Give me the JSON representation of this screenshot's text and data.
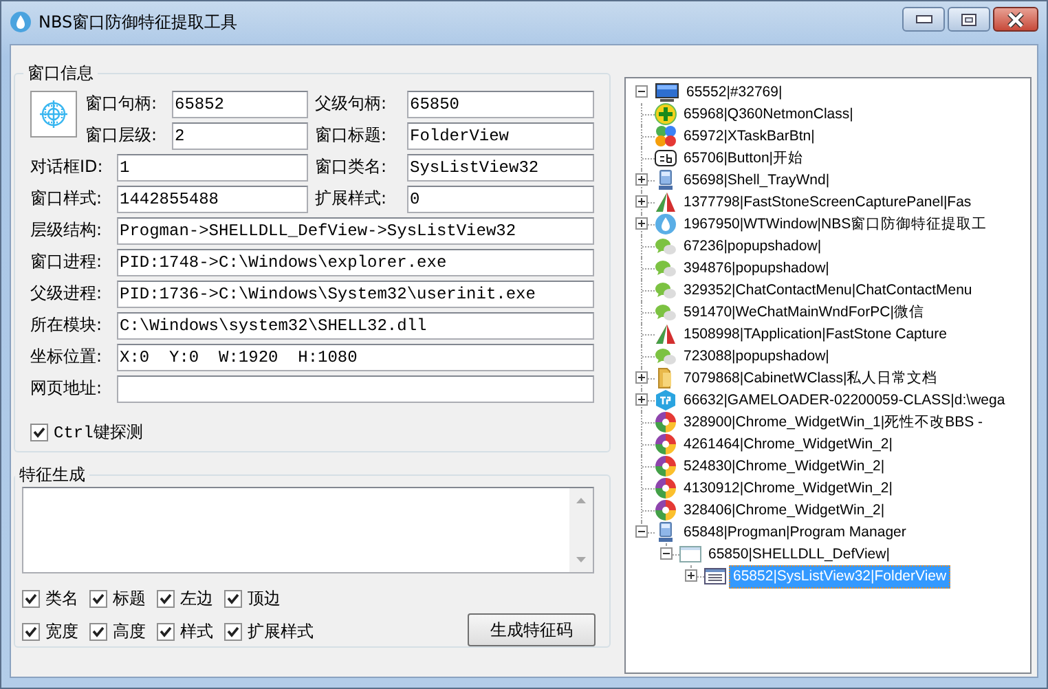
{
  "window": {
    "title": "NBS窗口防御特征提取工具"
  },
  "window_info": {
    "title": "窗口信息",
    "paired_rows": [
      {
        "left": {
          "label": "窗口句柄:",
          "value": "65852"
        },
        "right": {
          "label": "父级句柄:",
          "value": "65850"
        }
      },
      {
        "left": {
          "label": "窗口层级:",
          "value": "2"
        },
        "right": {
          "label": "窗口标题:",
          "value": "FolderView"
        }
      },
      {
        "left": {
          "label": "对话框ID:",
          "value": "1"
        },
        "right": {
          "label": "窗口类名:",
          "value": "SysListView32"
        }
      },
      {
        "left": {
          "label": "窗口样式:",
          "value": "1442855488"
        },
        "right": {
          "label": "扩展样式:",
          "value": "0"
        }
      }
    ],
    "full_rows": [
      {
        "label": "层级结构:",
        "value": "Progman->SHELLDLL_DefView->SysListView32"
      },
      {
        "label": "窗口进程:",
        "value": "PID:1748->C:\\Windows\\explorer.exe"
      },
      {
        "label": "父级进程:",
        "value": "PID:1736->C:\\Windows\\System32\\userinit.exe"
      },
      {
        "label": "所在模块:",
        "value": "C:\\Windows\\system32\\SHELL32.dll"
      },
      {
        "label": "坐标位置:",
        "value": "X:0  Y:0  W:1920  H:1080"
      },
      {
        "label": "网页地址:"
      }
    ],
    "ctrl_probe": {
      "label": "Ctrl键探测",
      "checked": true
    }
  },
  "feature": {
    "title": "特征生成",
    "options": [
      {
        "label": "类名",
        "checked": true
      },
      {
        "label": "标题",
        "checked": true
      },
      {
        "label": "左边",
        "checked": true
      },
      {
        "label": "顶边",
        "checked": true
      },
      {
        "label": "宽度",
        "checked": true
      },
      {
        "label": "高度",
        "checked": true
      },
      {
        "label": "样式",
        "checked": true
      },
      {
        "label": "扩展样式",
        "checked": true
      }
    ],
    "button": "生成特征码"
  },
  "tree": {
    "nodes": [
      {
        "label": "65552|#32769|",
        "kind": "monitor",
        "expanded": true,
        "selected": false,
        "children": [
          {
            "label": "65968|Q360NetmonClass|",
            "kind": "plus",
            "selected": false
          },
          {
            "label": "65972|XTaskBarBtn|",
            "kind": "balls",
            "selected": false
          },
          {
            "label": "65706|Button|开始",
            "kind": "textbox",
            "selected": false
          },
          {
            "label": "65698|Shell_TrayWnd|",
            "kind": "computer",
            "expanded": false,
            "selected": false
          },
          {
            "label": "1377798|FastStoneScreenCapturePanel|Fas",
            "kind": "triangle",
            "expanded": false,
            "selected": false
          },
          {
            "label": "1967950|WTWindow|NBS窗口防御特征提取工",
            "kind": "drop",
            "expanded": false,
            "selected": false
          },
          {
            "label": "67236|popupshadow|",
            "kind": "chat",
            "selected": false
          },
          {
            "label": "394876|popupshadow|",
            "kind": "chat",
            "selected": false
          },
          {
            "label": "329352|ChatContactMenu|ChatContactMenu",
            "kind": "chat",
            "selected": false
          },
          {
            "label": "591470|WeChatMainWndForPC|微信",
            "kind": "chat",
            "selected": false
          },
          {
            "label": "1508998|TApplication|FastStone Capture",
            "kind": "triangle",
            "selected": false
          },
          {
            "label": "723088|popupshadow|",
            "kind": "chat",
            "selected": false
          },
          {
            "label": "7079868|CabinetWClass|私人日常文档",
            "kind": "folder",
            "expanded": false,
            "selected": false
          },
          {
            "label": "66632|GAMELOADER-02200059-CLASS|d:\\wega",
            "kind": "hexagon",
            "expanded": false,
            "selected": false
          },
          {
            "label": "328900|Chrome_WidgetWin_1|死性不改BBS -",
            "kind": "wheel",
            "selected": false
          },
          {
            "label": "4261464|Chrome_WidgetWin_2|",
            "kind": "wheel",
            "selected": false
          },
          {
            "label": "524830|Chrome_WidgetWin_2|",
            "kind": "wheel",
            "selected": false
          },
          {
            "label": "4130912|Chrome_WidgetWin_2|",
            "kind": "wheel",
            "selected": false
          },
          {
            "label": "328406|Chrome_WidgetWin_2|",
            "kind": "wheel",
            "selected": false
          },
          {
            "label": "65848|Progman|Program Manager",
            "kind": "computer",
            "expanded": true,
            "selected": false,
            "children": [
              {
                "label": "65850|SHELLDLL_DefView|",
                "kind": "window",
                "expanded": true,
                "selected": false,
                "children": [
                  {
                    "label": "65852|SysListView32|FolderView",
                    "kind": "list",
                    "expanded": false,
                    "selected": true
                  }
                ]
              }
            ]
          }
        ]
      }
    ]
  }
}
